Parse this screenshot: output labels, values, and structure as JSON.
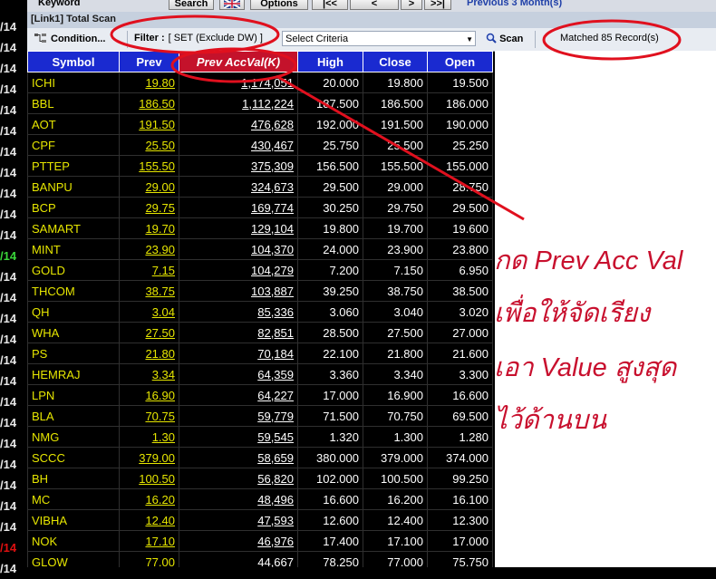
{
  "left_dates": [
    "/14",
    "/14",
    "/14",
    "/14",
    "/14",
    "/14",
    "/14",
    "/14",
    "/14",
    "/14",
    "/14",
    "/14",
    "/14",
    "/14",
    "/14",
    "/14",
    "/14",
    "/14",
    "/14",
    "/14",
    "/14",
    "/14",
    "/14",
    "/14",
    "/14",
    "/14",
    "/14"
  ],
  "topbar": {
    "keyword": "Keyword",
    "search": "Search",
    "options": "Options",
    "first": "|<<",
    "prev": "<",
    "next": ">",
    "last": ">>|",
    "previous_range": "Previous 3 Month(s)"
  },
  "window_title": "[Link1] Total Scan",
  "toolbar": {
    "condition": "Condition...",
    "filter_label": "Filter :",
    "filter_value": "[ SET (Exclude DW) ]",
    "criteria_placeholder": "Select Criteria",
    "scan": "Scan",
    "matched": "Matched 85 Record(s)"
  },
  "columns": [
    "Symbol",
    "Prev",
    "Prev AccVal(K)",
    "High",
    "Close",
    "Open"
  ],
  "rows": [
    [
      "ICHI",
      "19.80",
      "1,174,051",
      "20.000",
      "19.800",
      "19.500"
    ],
    [
      "BBL",
      "186.50",
      "1,112,224",
      "187.500",
      "186.500",
      "186.000"
    ],
    [
      "AOT",
      "191.50",
      "476,628",
      "192.000",
      "191.500",
      "190.000"
    ],
    [
      "CPF",
      "25.50",
      "430,467",
      "25.750",
      "25.500",
      "25.250"
    ],
    [
      "PTTEP",
      "155.50",
      "375,309",
      "156.500",
      "155.500",
      "155.000"
    ],
    [
      "BANPU",
      "29.00",
      "324,673",
      "29.500",
      "29.000",
      "28.750"
    ],
    [
      "BCP",
      "29.75",
      "169,774",
      "30.250",
      "29.750",
      "29.500"
    ],
    [
      "SAMART",
      "19.70",
      "129,104",
      "19.800",
      "19.700",
      "19.600"
    ],
    [
      "MINT",
      "23.90",
      "104,370",
      "24.000",
      "23.900",
      "23.800"
    ],
    [
      "GOLD",
      "7.15",
      "104,279",
      "7.200",
      "7.150",
      "6.950"
    ],
    [
      "THCOM",
      "38.75",
      "103,887",
      "39.250",
      "38.750",
      "38.500"
    ],
    [
      "QH",
      "3.04",
      "85,336",
      "3.060",
      "3.040",
      "3.020"
    ],
    [
      "WHA",
      "27.50",
      "82,851",
      "28.500",
      "27.500",
      "27.000"
    ],
    [
      "PS",
      "21.80",
      "70,184",
      "22.100",
      "21.800",
      "21.600"
    ],
    [
      "HEMRAJ",
      "3.34",
      "64,359",
      "3.360",
      "3.340",
      "3.300"
    ],
    [
      "LPN",
      "16.90",
      "64,227",
      "17.000",
      "16.900",
      "16.600"
    ],
    [
      "BLA",
      "70.75",
      "59,779",
      "71.500",
      "70.750",
      "69.500"
    ],
    [
      "NMG",
      "1.30",
      "59,545",
      "1.320",
      "1.300",
      "1.280"
    ],
    [
      "SCCC",
      "379.00",
      "58,659",
      "380.000",
      "379.000",
      "374.000"
    ],
    [
      "BH",
      "100.50",
      "56,820",
      "102.000",
      "100.500",
      "99.250"
    ],
    [
      "MC",
      "16.20",
      "48,496",
      "16.600",
      "16.200",
      "16.100"
    ],
    [
      "VIBHA",
      "12.40",
      "47,593",
      "12.600",
      "12.400",
      "12.300"
    ],
    [
      "NOK",
      "17.10",
      "46,976",
      "17.400",
      "17.100",
      "17.000"
    ],
    [
      "GLOW",
      "77.00",
      "44,667",
      "78.250",
      "77.000",
      "75.750"
    ]
  ],
  "annotation": {
    "lines": [
      "กด Prev Acc Val",
      "เพื่อให้จัดเรียง",
      "เอา Value สูงสุด",
      "ไว้ด้านบน"
    ]
  },
  "colors": {
    "header_bg": "#1a2ad0",
    "sorted_header_bg": "#c4122b",
    "symbol_text": "#e6e600",
    "annotation_red": "#c8102e"
  }
}
